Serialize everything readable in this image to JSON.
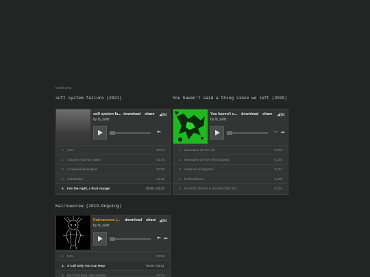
{
  "bandcamp_link": "bandcamp",
  "sections": [
    {
      "title": "soft system failure (2021)",
      "player": {
        "title": "soft system fa...",
        "download": "download",
        "share": "share",
        "bc": "◢▯bc",
        "artist": "by lb_saltz",
        "tracks": [
          {
            "num": "1.",
            "name": "intro",
            "dur": "00:24"
          },
          {
            "num": "2.",
            "name": "it doesn't have to matter",
            "dur": "01:45"
          },
          {
            "num": "3.",
            "name": "a moment interrupted",
            "dur": "00:39"
          },
          {
            "num": "4.",
            "name": "substitution",
            "dur": "01:32"
          },
          {
            "num": "5.",
            "name": "Into the night, a final voyage",
            "dur": "00:00 / 03:22"
          }
        ]
      }
    },
    {
      "title": "You haven't said a thing since we left (2019)",
      "player": {
        "title": "You haven't s...",
        "download": "download",
        "share": "share",
        "bc": "◢▯bc",
        "artist": "by lb_saltz",
        "tracks": [
          {
            "num": "1.",
            "name": "Mountains On the Hill",
            "dur": "02:30"
          },
          {
            "num": "2.",
            "name": "Mountains On the Hill (reduced)",
            "dur": "01:50"
          },
          {
            "num": "3.",
            "name": "waste to be forgotten",
            "dur": "01:53"
          },
          {
            "num": "4.",
            "name": "brokenblues 1",
            "dur": "01:59"
          },
          {
            "num": "5.",
            "name": "PLASTIC BRAIN in the MOLTEN SEA",
            "dur": "03:04"
          }
        ]
      }
    },
    {
      "title": "Kairnavorea (2019-Ongoing)",
      "player": {
        "title": "Kairnavorea (...",
        "download": "download",
        "share": "share",
        "bc": "◢▯bc",
        "artist": "by lb_saltz",
        "tracks": [
          {
            "num": "1.",
            "name": "Intro",
            "dur": "00:58"
          },
          {
            "num": "2.",
            "name": "A Call Only You Can Hear",
            "dur": "00:00 / 03:41"
          },
          {
            "num": "3.",
            "name": "the Coral King, who wielded",
            "dur": "03:22"
          }
        ]
      }
    }
  ]
}
